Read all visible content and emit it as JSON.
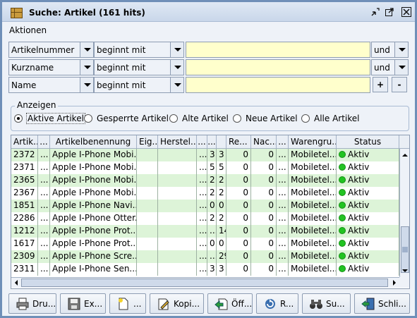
{
  "window": {
    "title": "Suche: Artikel (161 hits)",
    "title_buttons": [
      "minimize-icon",
      "maximize-icon",
      "close-icon"
    ]
  },
  "menubar": {
    "aktionen": "Aktionen"
  },
  "filters": [
    {
      "field": "Artikelnummer",
      "operator": "beginnt mit",
      "value": "",
      "conjunction": "und"
    },
    {
      "field": "Kurzname",
      "operator": "beginnt mit",
      "value": "",
      "conjunction": "und"
    },
    {
      "field": "Name",
      "operator": "beginnt mit",
      "value": "",
      "add": "+",
      "remove": "-"
    }
  ],
  "anzeigen": {
    "title": "Anzeigen",
    "options": [
      "Aktive Artikel",
      "Gesperrte Artikel",
      "Alte Artikel",
      "Neue Artikel",
      "Alle Artikel"
    ],
    "selected": "Aktive Artikel"
  },
  "table": {
    "headers": [
      "Artik...",
      "...",
      "Artikelbenennung",
      "Eig...",
      "Herstel...",
      "...",
      "...",
      "Re...",
      "Nac...",
      "...",
      "Warengru...",
      "Status"
    ],
    "rows": [
      [
        "2372",
        "...",
        "Apple I-Phone Mobi...",
        "",
        "",
        "...",
        "3",
        "3",
        "0",
        "0",
        "...",
        "Mobiletel...",
        "Aktiv"
      ],
      [
        "2371",
        "...",
        "Apple I-Phone Mobi...",
        "",
        "",
        "...",
        "5",
        "5",
        "0",
        "0",
        "...",
        "Mobiletel...",
        "Aktiv"
      ],
      [
        "2365",
        "...",
        "Apple I-Phone Mobi...",
        "",
        "",
        "...",
        "2",
        "2",
        "0",
        "0",
        "...",
        "Mobiletel...",
        "Aktiv"
      ],
      [
        "2367",
        "...",
        "Apple I-Phone Mobi...",
        "",
        "",
        "...",
        "2",
        "2",
        "0",
        "0",
        "...",
        "Mobiletel...",
        "Aktiv"
      ],
      [
        "1851",
        "...",
        "Apple I-Phone Navi...",
        "",
        "",
        "...",
        "0",
        "0",
        "0",
        "0",
        "...",
        "Mobiletel...",
        "Aktiv"
      ],
      [
        "2286",
        "...",
        "Apple I-Phone Otter...",
        "",
        "",
        "...",
        "2",
        "2",
        "0",
        "0",
        "...",
        "Mobiletel...",
        "Aktiv"
      ],
      [
        "1212",
        "...",
        "Apple I-Phone Prot...",
        "",
        "",
        "...",
        "...",
        "14",
        "0",
        "0",
        "...",
        "Mobiletel...",
        "Aktiv"
      ],
      [
        "1617",
        "...",
        "Apple I-Phone Prot...",
        "",
        "",
        "...",
        "0",
        "0",
        "0",
        "0",
        "...",
        "Mobiletel...",
        "Aktiv"
      ],
      [
        "2309",
        "...",
        "Apple I-Phone Scre...",
        "",
        "",
        "...",
        "...",
        "29",
        "0",
        "0",
        "...",
        "Mobiletel...",
        "Aktiv"
      ],
      [
        "2311",
        "...",
        "Apple I-Phone Sen...",
        "",
        "",
        "...",
        "3",
        "3",
        "0",
        "0",
        "...",
        "Mobiletel...",
        "Aktiv"
      ]
    ],
    "status_color": "#22c322",
    "row_colors": {
      "even": "#ddf4d8",
      "odd": "#ffffff"
    }
  },
  "buttons": [
    {
      "label": "Dru...",
      "icon": "printer-icon"
    },
    {
      "label": "Ex...",
      "icon": "floppy-disk-icon"
    },
    {
      "label": "...",
      "icon": "new-document-icon"
    },
    {
      "label": "Kopi...",
      "icon": "edit-copy-icon"
    },
    {
      "label": "Öff...",
      "icon": "open-arrow-icon"
    },
    {
      "label": "R...",
      "icon": "refresh-icon"
    },
    {
      "label": "Su...",
      "icon": "binoculars-icon"
    },
    {
      "label": "Schli...",
      "icon": "exit-door-icon"
    }
  ]
}
